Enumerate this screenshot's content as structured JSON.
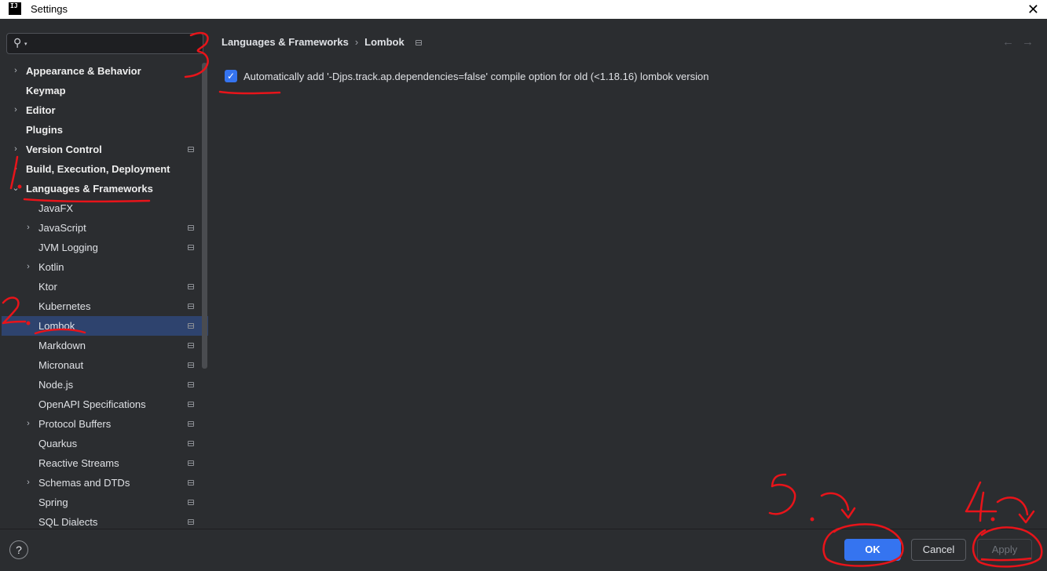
{
  "window": {
    "title": "Settings",
    "app_icon_text": "IJ"
  },
  "search": {
    "value": "",
    "placeholder": ""
  },
  "sidebar": {
    "items": [
      {
        "label": "Appearance & Behavior",
        "level": "top",
        "expandable": true,
        "expanded": false,
        "project": false,
        "selected": false
      },
      {
        "label": "Keymap",
        "level": "top",
        "expandable": false,
        "expanded": false,
        "project": false,
        "selected": false
      },
      {
        "label": "Editor",
        "level": "top",
        "expandable": true,
        "expanded": false,
        "project": false,
        "selected": false
      },
      {
        "label": "Plugins",
        "level": "top",
        "expandable": false,
        "expanded": false,
        "project": false,
        "selected": false
      },
      {
        "label": "Version Control",
        "level": "top",
        "expandable": true,
        "expanded": false,
        "project": true,
        "selected": false
      },
      {
        "label": "Build, Execution, Deployment",
        "level": "top",
        "expandable": true,
        "expanded": false,
        "project": false,
        "selected": false
      },
      {
        "label": "Languages & Frameworks",
        "level": "top",
        "expandable": true,
        "expanded": true,
        "project": false,
        "selected": false
      },
      {
        "label": "JavaFX",
        "level": "sub",
        "expandable": false,
        "expanded": false,
        "project": false,
        "selected": false
      },
      {
        "label": "JavaScript",
        "level": "sub",
        "expandable": true,
        "expanded": false,
        "project": true,
        "selected": false
      },
      {
        "label": "JVM Logging",
        "level": "sub",
        "expandable": false,
        "expanded": false,
        "project": true,
        "selected": false
      },
      {
        "label": "Kotlin",
        "level": "sub",
        "expandable": true,
        "expanded": false,
        "project": false,
        "selected": false
      },
      {
        "label": "Ktor",
        "level": "sub",
        "expandable": false,
        "expanded": false,
        "project": true,
        "selected": false
      },
      {
        "label": "Kubernetes",
        "level": "sub",
        "expandable": false,
        "expanded": false,
        "project": true,
        "selected": false
      },
      {
        "label": "Lombok",
        "level": "sub",
        "expandable": false,
        "expanded": false,
        "project": true,
        "selected": true
      },
      {
        "label": "Markdown",
        "level": "sub",
        "expandable": false,
        "expanded": false,
        "project": true,
        "selected": false
      },
      {
        "label": "Micronaut",
        "level": "sub",
        "expandable": false,
        "expanded": false,
        "project": true,
        "selected": false
      },
      {
        "label": "Node.js",
        "level": "sub",
        "expandable": false,
        "expanded": false,
        "project": true,
        "selected": false
      },
      {
        "label": "OpenAPI Specifications",
        "level": "sub",
        "expandable": false,
        "expanded": false,
        "project": true,
        "selected": false
      },
      {
        "label": "Protocol Buffers",
        "level": "sub",
        "expandable": true,
        "expanded": false,
        "project": true,
        "selected": false
      },
      {
        "label": "Quarkus",
        "level": "sub",
        "expandable": false,
        "expanded": false,
        "project": true,
        "selected": false
      },
      {
        "label": "Reactive Streams",
        "level": "sub",
        "expandable": false,
        "expanded": false,
        "project": true,
        "selected": false
      },
      {
        "label": "Schemas and DTDs",
        "level": "sub",
        "expandable": true,
        "expanded": false,
        "project": true,
        "selected": false
      },
      {
        "label": "Spring",
        "level": "sub",
        "expandable": false,
        "expanded": false,
        "project": true,
        "selected": false
      },
      {
        "label": "SQL Dialects",
        "level": "sub",
        "expandable": false,
        "expanded": false,
        "project": true,
        "selected": false
      }
    ]
  },
  "breadcrumb": {
    "parent": "Languages & Frameworks",
    "separator": "›",
    "current": "Lombok"
  },
  "nav": {
    "back": "←",
    "forward": "→"
  },
  "option": {
    "checked": true,
    "label": "Automatically add '-Djps.track.ap.dependencies=false' compile option for old (<1.18.16) lombok version"
  },
  "footer": {
    "help": "?",
    "ok": "OK",
    "cancel": "Cancel",
    "apply": "Apply"
  },
  "annotations": {
    "color": "#e8141a",
    "marks": [
      "1.",
      "2.",
      "3",
      "4.",
      "5."
    ]
  },
  "colors": {
    "accent": "#3574f0",
    "selection": "#2e436e",
    "background": "#2b2d30"
  }
}
